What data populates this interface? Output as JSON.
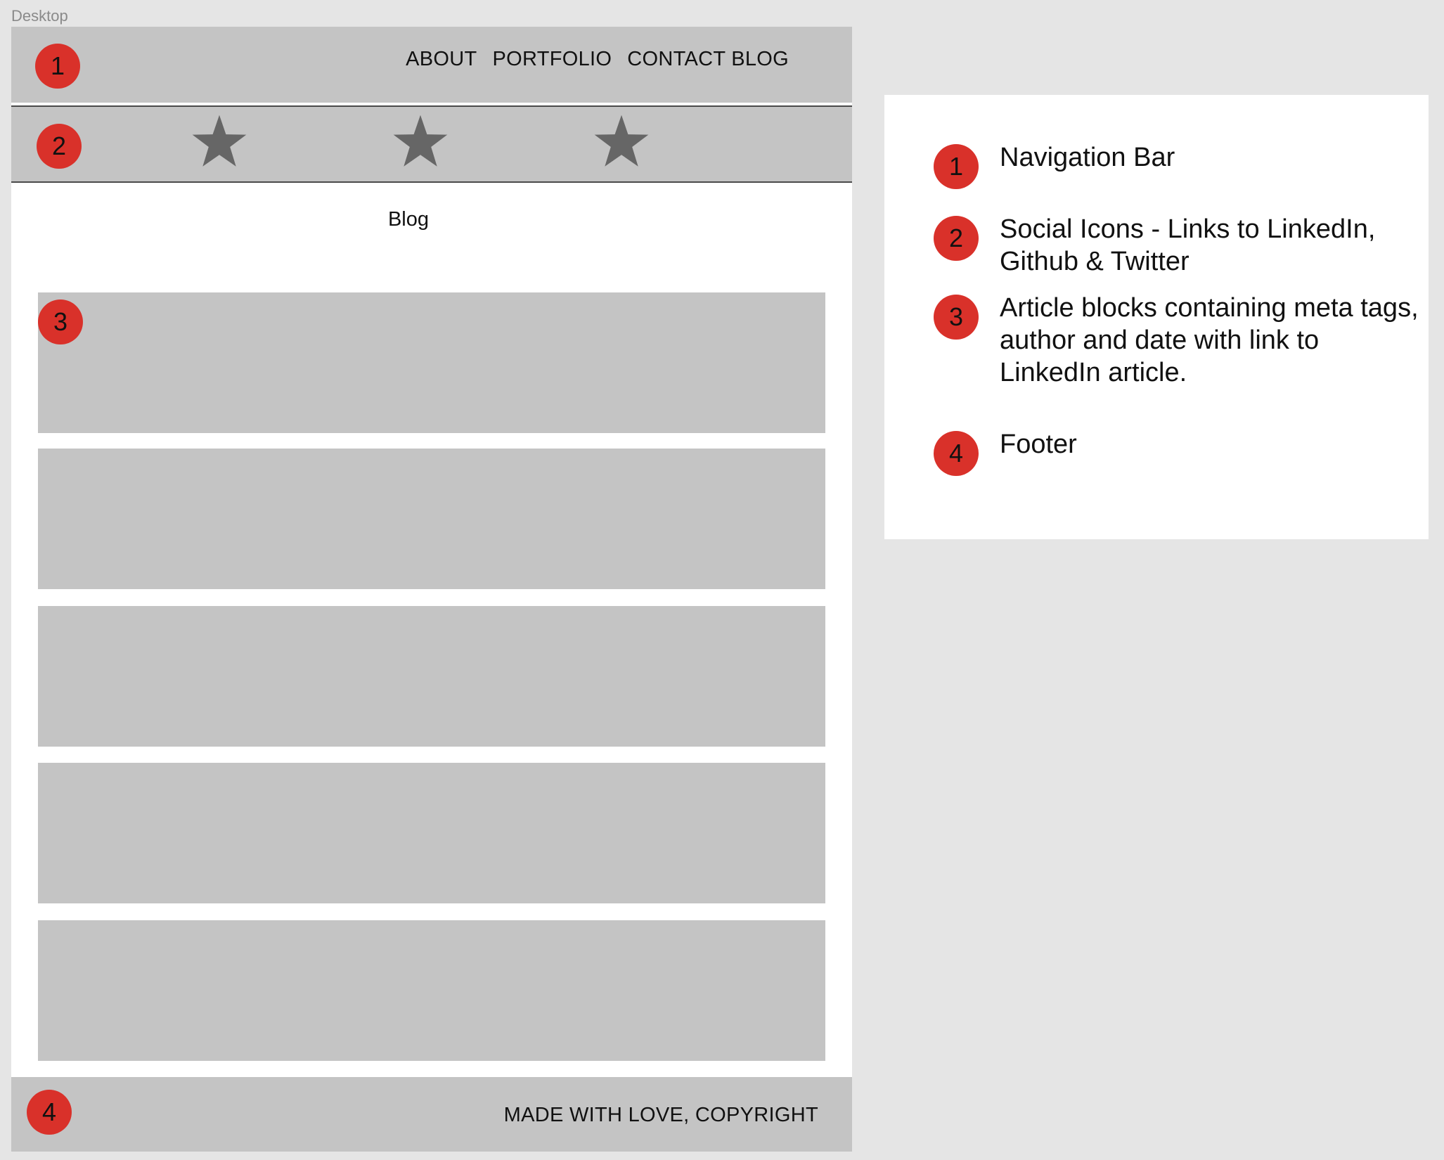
{
  "frame": {
    "label": "Desktop"
  },
  "nav": {
    "marker": "1",
    "links": [
      "ABOUT",
      "PORTFOLIO",
      "CONTACT BLOG"
    ]
  },
  "social": {
    "marker": "2",
    "icons": [
      "star-icon",
      "star-icon",
      "star-icon"
    ],
    "icon_color": "#666666"
  },
  "main": {
    "title": "Blog",
    "marker": "3",
    "article_count": 5
  },
  "footer": {
    "marker": "4",
    "text": "MADE WITH LOVE, COPYRIGHT"
  },
  "legend": {
    "items": [
      {
        "number": "1",
        "text": "Navigation Bar"
      },
      {
        "number": "2",
        "text": "Social Icons - Links to LinkedIn, Github & Twitter"
      },
      {
        "number": "3",
        "text": "Article blocks containing meta tags, author and date with link to LinkedIn article."
      },
      {
        "number": "4",
        "text": "Footer"
      }
    ]
  },
  "colors": {
    "background": "#e5e5e5",
    "placeholder": "#c4c4c4",
    "marker": "#d9312a",
    "artboard": "#ffffff"
  }
}
